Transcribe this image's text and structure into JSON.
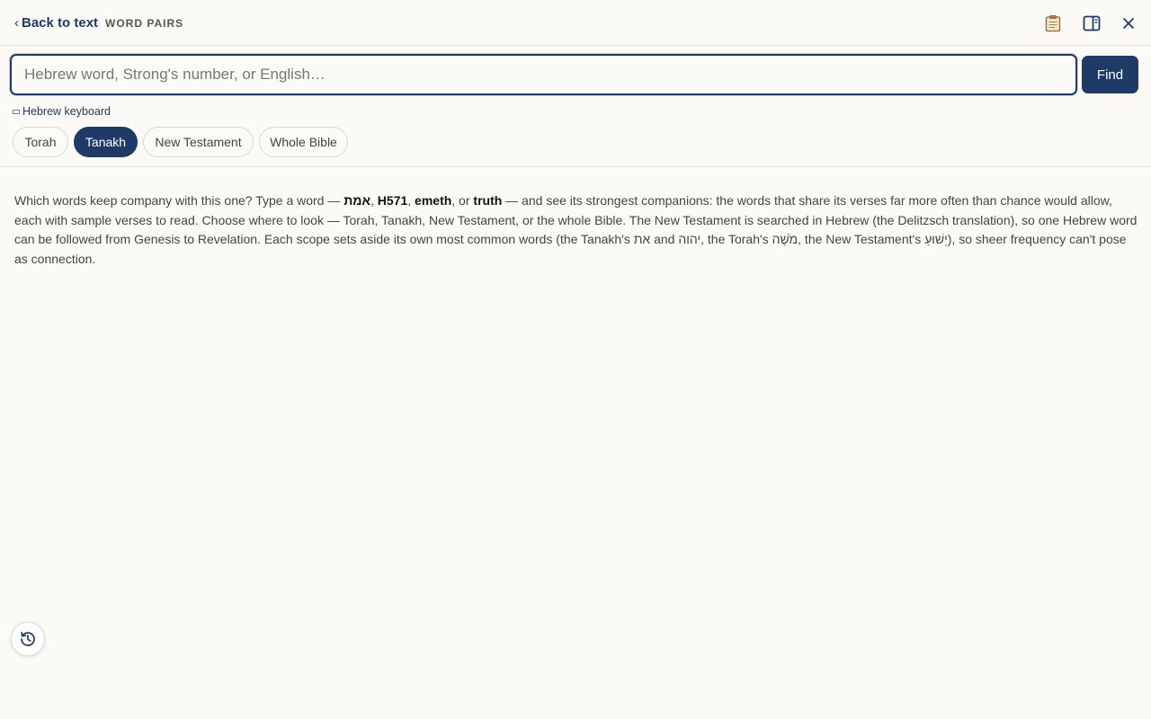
{
  "header": {
    "back_label": "Back to text",
    "back_chevron": "‹",
    "title": "WORD PAIRS",
    "icons": [
      "notes-icon",
      "side-panel-icon",
      "close-icon"
    ]
  },
  "search": {
    "placeholder": "Hebrew word, Strong's number, or English…",
    "value": "",
    "find_label": "Find",
    "keyboard_label": "Hebrew keyboard"
  },
  "scopes": {
    "items": [
      "Torah",
      "Tanakh",
      "New Testament",
      "Whole Bible"
    ],
    "selected": "Tanakh"
  },
  "intro": {
    "p1": "Which words keep company with this one? Type a word — ",
    "ex1": "אמת",
    "sep1": ", ",
    "ex2": "H571",
    "sep2": ", ",
    "ex3": "emeth",
    "sep3": ", or ",
    "ex4": "truth",
    "p2": " — and see its strongest companions: the words that share its verses far more often than chance would allow, each with sample verses to read. Choose where to look — Torah, Tanakh, New Testament, or the whole Bible. The New Testament is searched in Hebrew (the Delitzsch translation), so one Hebrew word can be followed from Genesis to Revelation. Each scope sets aside its own most common words (the Tanakh's ",
    "w1": "את",
    "p3": " and ",
    "w2": "יהוה",
    "p4": ", the Torah's ",
    "w3": "מֹשֶׁה",
    "p5": ", the New Testament's ",
    "w4": "יֵשׁוּעַ",
    "p6": "), so sheer frequency can't pose as connection."
  },
  "colors": {
    "accent": "#1f3a66",
    "background": "#fbfaf7",
    "border": "#e3e0d9"
  }
}
